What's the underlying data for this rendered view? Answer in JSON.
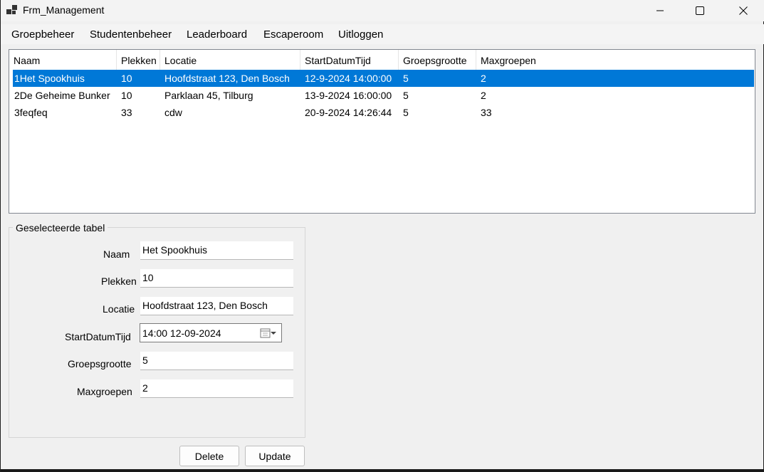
{
  "window": {
    "title": "Frm_Management"
  },
  "menu": {
    "items": [
      "Groepbeheer",
      "Studentenbeheer",
      "Leaderboard",
      "Escaperoom",
      "Uitloggen"
    ]
  },
  "list": {
    "columns": [
      "Naam",
      "Plekken",
      "Locatie",
      "StartDatumTijd",
      "Groepsgrootte",
      "Maxgroepen"
    ],
    "rows": [
      [
        "1Het Spookhuis",
        "10",
        "Hoofdstraat 123, Den Bosch",
        "12-9-2024 14:00:00",
        "5",
        "2"
      ],
      [
        "2De Geheime Bunker",
        "10",
        "Parklaan 45, Tilburg",
        "13-9-2024 16:00:00",
        "5",
        "2"
      ],
      [
        "3feqfeq",
        "33",
        "cdw",
        "20-9-2024 14:26:44",
        "5",
        "33"
      ]
    ],
    "selected_row": 0
  },
  "details": {
    "group_title": "Geselecteerde tabel",
    "naam_label": "Naam",
    "naam_value": "Het Spookhuis",
    "plekken_label": "Plekken",
    "plekken_value": "10",
    "locatie_label": "Locatie",
    "locatie_value": "Hoofdstraat 123, Den Bosch",
    "start_label": "StartDatumTijd",
    "start_value": "14:00 12-09-2024",
    "groepsgrootte_label": "Groepsgrootte",
    "groepsgrootte_value": "5",
    "maxgroepen_label": "Maxgroepen",
    "maxgroepen_value": "2"
  },
  "buttons": {
    "delete": "Delete",
    "update": "Update"
  },
  "colors": {
    "selection": "#0078d7",
    "window_bg": "#f0f0f0"
  },
  "icons": {
    "app": "app-icon",
    "minimize": "minimize-icon",
    "maximize": "maximize-icon",
    "close": "close-icon",
    "calendar": "calendar-icon"
  }
}
